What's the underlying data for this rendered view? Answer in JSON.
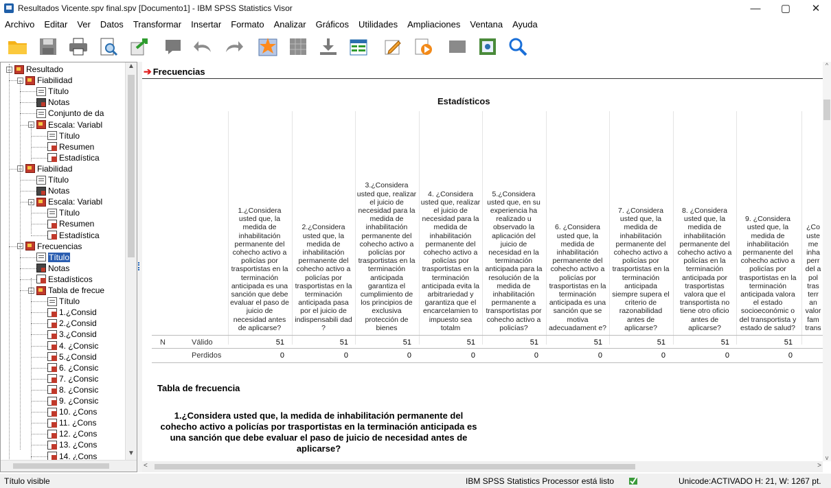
{
  "window": {
    "title": "Resultados Vicente.spv final.spv [Documento1] - IBM SPSS Statistics Visor",
    "minimize": "—",
    "maximize": "▢",
    "close": "✕"
  },
  "menu": [
    "Archivo",
    "Editar",
    "Ver",
    "Datos",
    "Transformar",
    "Insertar",
    "Formato",
    "Analizar",
    "Gráficos",
    "Utilidades",
    "Ampliaciones",
    "Ventana",
    "Ayuda"
  ],
  "toolbar": [
    "open-folder-icon",
    "save-icon",
    "print-icon",
    "print-preview-icon",
    "export-icon",
    "recall-dialog-icon",
    "undo-icon",
    "redo-icon",
    "goto-case-icon",
    "goto-variable-icon",
    "variables-icon",
    "insert-table-icon",
    "edit-icon",
    "designate-window-icon",
    "select-last-output-icon",
    "show-selected-icon",
    "search-icon"
  ],
  "tree": {
    "items": [
      {
        "label": "Resultado",
        "icon": "book",
        "expand": "−"
      },
      {
        "label": "Fiabilidad",
        "icon": "book",
        "expand": "−"
      },
      {
        "label": "Título",
        "icon": "title"
      },
      {
        "label": "Notas",
        "icon": "notes"
      },
      {
        "label": "Conjunto de da",
        "icon": "title"
      },
      {
        "label": "Escala: Variabl",
        "icon": "book",
        "expand": "−"
      },
      {
        "label": "Título",
        "icon": "title"
      },
      {
        "label": "Resumen",
        "icon": "table"
      },
      {
        "label": "Estadística",
        "icon": "table"
      },
      {
        "label": "Fiabilidad",
        "icon": "book",
        "expand": "−"
      },
      {
        "label": "Título",
        "icon": "title"
      },
      {
        "label": "Notas",
        "icon": "notes"
      },
      {
        "label": "Escala: Variabl",
        "icon": "book",
        "expand": "−"
      },
      {
        "label": "Título",
        "icon": "title"
      },
      {
        "label": "Resumen",
        "icon": "table"
      },
      {
        "label": "Estadística",
        "icon": "table"
      },
      {
        "label": "Frecuencias",
        "icon": "book",
        "expand": "−"
      },
      {
        "label": "Título",
        "icon": "title",
        "selected": true
      },
      {
        "label": "Notas",
        "icon": "notes"
      },
      {
        "label": "Estadísticos",
        "icon": "table"
      },
      {
        "label": "Tabla de frecue",
        "icon": "book",
        "expand": "−"
      },
      {
        "label": "Título",
        "icon": "title"
      },
      {
        "label": "1.¿Consid",
        "icon": "table"
      },
      {
        "label": "2.¿Consid",
        "icon": "table"
      },
      {
        "label": "3.¿Consid",
        "icon": "table"
      },
      {
        "label": "4. ¿Consic",
        "icon": "table"
      },
      {
        "label": "5.¿Consid",
        "icon": "table"
      },
      {
        "label": "6. ¿Consic",
        "icon": "table"
      },
      {
        "label": "7. ¿Consic",
        "icon": "table"
      },
      {
        "label": "8. ¿Consic",
        "icon": "table"
      },
      {
        "label": "9. ¿Consic",
        "icon": "table"
      },
      {
        "label": "10. ¿Cons",
        "icon": "table"
      },
      {
        "label": "11. ¿Cons",
        "icon": "table"
      },
      {
        "label": "12. ¿Cons",
        "icon": "table"
      },
      {
        "label": "13. ¿Cons",
        "icon": "table"
      },
      {
        "label": "14. ¿Cons",
        "icon": "table"
      }
    ]
  },
  "output": {
    "section": "Frecuencias",
    "stats_title": "Estadísticos",
    "row_n": "N",
    "row_valid": "Válido",
    "row_missing": "Perdidos",
    "columns": [
      {
        "header": "1.¿Considera usted que, la medida de inhabilitación permanente del cohecho activo a policías por trasportistas en la terminación anticipada es una sanción que debe evaluar el paso de juicio de necesidad antes de aplicarse?",
        "valid": "51",
        "missing": "0"
      },
      {
        "header": "2.¿Considera usted que, la medida de inhabilitación permanente del cohecho activo a policías por trasportistas en la terminación anticipada pasa por el juicio de indispensabili dad ?",
        "valid": "51",
        "missing": "0"
      },
      {
        "header": "3.¿Considera usted que, realizar el juicio de necesidad para la medida de inhabilitación permanente del cohecho activo a policías por trasportistas en la terminación anticipada garantiza el cumplimiento de los principios de exclusiva protección de bienes",
        "valid": "51",
        "missing": "0"
      },
      {
        "header": "4. ¿Considera usted que, realizar el juicio de necesidad para la medida de inhabilitación permanente del cohecho activo a policías por trasportistas en la terminación anticipada evita la arbitrariedad y garantiza que el encarcelamien to impuesto sea totalm",
        "valid": "51",
        "missing": "0"
      },
      {
        "header": "5.¿Considera usted que, en su experiencia ha realizado u observado la aplicación del juicio de necesidad en la terminación anticipada para la resolución de la medida de inhabilitación permanente a transportistas por cohecho activo a policías?",
        "valid": "51",
        "missing": "0"
      },
      {
        "header": "6. ¿Considera usted que, la medida de inhabilitación permanente del cohecho activo a policías por trasportistas en la terminación anticipada es una sanción que se motiva adecuadament e?",
        "valid": "51",
        "missing": "0"
      },
      {
        "header": "7. ¿Considera usted que, la medida de inhabilitación permanente del cohecho activo a policías por trasportistas en la terminación anticipada siempre supera el criterio de razonabilidad antes de aplicarse?",
        "valid": "51",
        "missing": "0"
      },
      {
        "header": "8. ¿Considera usted que, la medida de inhabilitación permanente del cohecho activo a policías en la terminación anticipada por trasportistas valora que el transportista no tiene otro oficio antes de aplicarse?",
        "valid": "51",
        "missing": "0"
      },
      {
        "header": "9. ¿Considera usted que, la medida de inhabilitación permanente del cohecho activo a policías por trasportistas en la terminación anticipada valora el estado socioeconómic o del transportista y estado de salud?",
        "valid": "51",
        "missing": "0"
      },
      {
        "header": "¿Co uste me inha perr del a pol tras terr an valor fam trans",
        "valid": "",
        "missing": ""
      }
    ],
    "freq_table_title": "Tabla de frecuencia",
    "question_title": "1.¿Considera usted que, la medida de inhabilitación permanente del cohecho activo a policías por trasportistas en la terminación anticipada es una sanción que debe evaluar el paso de juicio de necesidad antes de aplicarse?"
  },
  "status": {
    "left": "Título visible",
    "processor": "IBM SPSS Statistics Processor está listo",
    "encoding": "Unicode:ACTIVADO  H: 21, W: 1267 pt."
  }
}
